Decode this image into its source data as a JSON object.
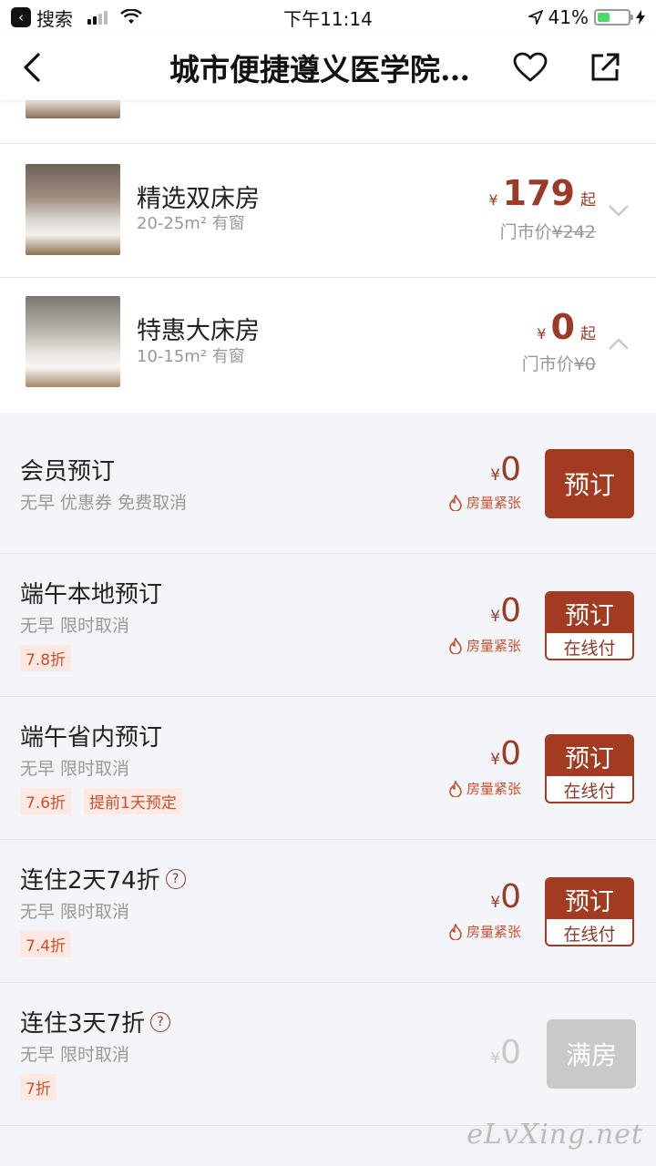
{
  "status_bar": {
    "back_app": "搜索",
    "time": "下午11:14",
    "battery": "41%",
    "battery_level": 0.41
  },
  "nav": {
    "title": "城市便捷遵义医学院…"
  },
  "rooms": [
    {
      "name": "精选双床房",
      "sub": "20-25m² 有窗",
      "currency": "¥",
      "price": "179",
      "qi": "起",
      "market_label": "门市价",
      "market_price": "¥242",
      "expanded": false
    },
    {
      "name": "特惠大床房",
      "sub": "10-15m² 有窗",
      "currency": "¥",
      "price": "0",
      "qi": "起",
      "market_label": "门市价",
      "market_price": "¥0",
      "expanded": true
    }
  ],
  "plans": [
    {
      "title": "会员预订",
      "desc": "无早 优惠券 免费取消",
      "tags": [],
      "currency": "¥",
      "price": "0",
      "scarce": "房量紧张",
      "button": "预订",
      "button_sub": ""
    },
    {
      "title": "端午本地预订",
      "desc": "无早 限时取消",
      "tags": [
        "7.8折"
      ],
      "currency": "¥",
      "price": "0",
      "scarce": "房量紧张",
      "button": "预订",
      "button_sub": "在线付"
    },
    {
      "title": "端午省内预订",
      "desc": "无早 限时取消",
      "tags": [
        "7.6折",
        "提前1天预定"
      ],
      "currency": "¥",
      "price": "0",
      "scarce": "房量紧张",
      "button": "预订",
      "button_sub": "在线付"
    },
    {
      "title": "连住2天74折",
      "desc": "无早 限时取消",
      "tags": [
        "7.4折"
      ],
      "currency": "¥",
      "price": "0",
      "scarce": "房量紧张",
      "button": "预订",
      "button_sub": "在线付"
    },
    {
      "title": "连住3天7折",
      "desc": "无早 限时取消",
      "tags": [
        "7折"
      ],
      "currency": "¥",
      "price": "0",
      "scarce": "",
      "button": "满房",
      "button_sub": ""
    }
  ],
  "watermark": "eLvXing.net",
  "colors": {
    "accent": "#a33a22",
    "price": "#9a3a27",
    "tag_text": "#c9502f",
    "tag_bg": "#fde9e2",
    "disabled": "#c9c9cc"
  }
}
